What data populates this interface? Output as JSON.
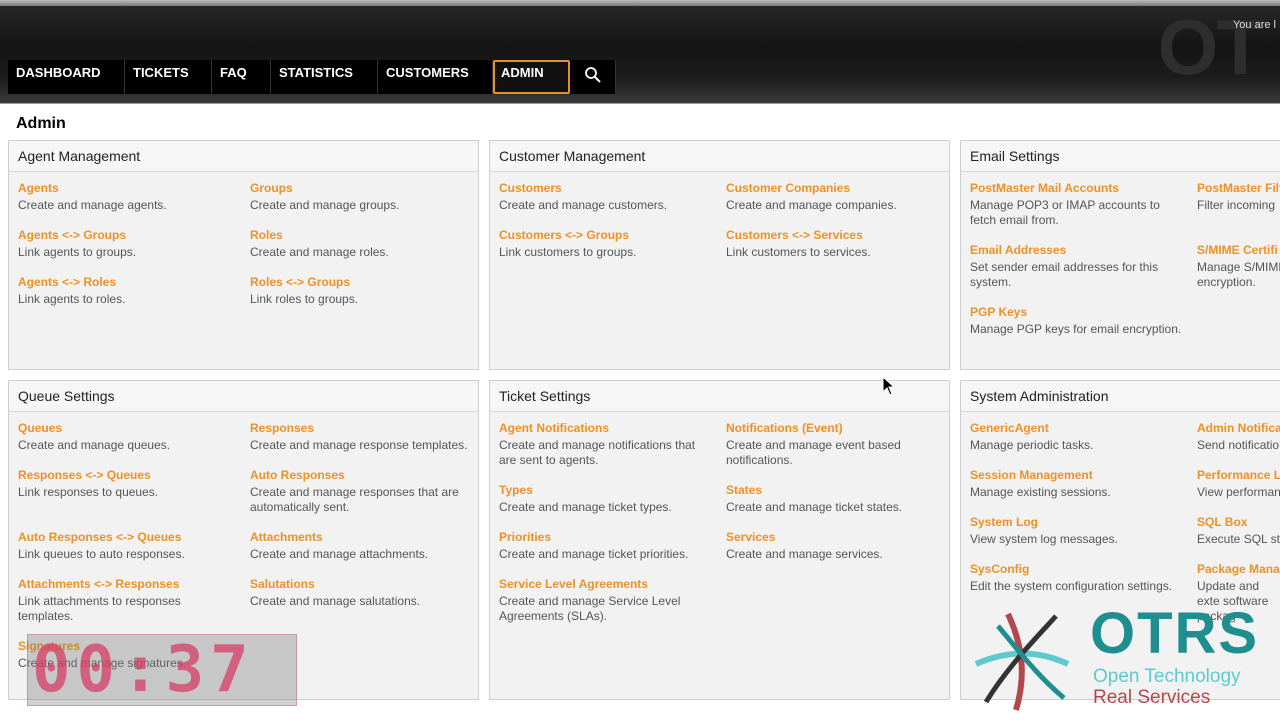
{
  "header": {
    "watermark": "OT",
    "user_text": "You are l"
  },
  "nav": {
    "items": [
      "DASHBOARD",
      "TICKETS",
      "FAQ",
      "STATISTICS",
      "CUSTOMERS",
      "ADMIN"
    ],
    "active": "ADMIN",
    "search_icon": "search-icon"
  },
  "page_title": "Admin",
  "panels": {
    "agent": {
      "title": "Agent Management",
      "entries": [
        {
          "link": "Agents",
          "desc": "Create and manage agents."
        },
        {
          "link": "Groups",
          "desc": "Create and manage groups."
        },
        {
          "link": "Agents <-> Groups",
          "desc": "Link agents to groups."
        },
        {
          "link": "Roles",
          "desc": "Create and manage roles."
        },
        {
          "link": "Agents <-> Roles",
          "desc": "Link agents to roles."
        },
        {
          "link": "Roles <-> Groups",
          "desc": "Link roles to groups."
        }
      ]
    },
    "customer": {
      "title": "Customer Management",
      "entries": [
        {
          "link": "Customers",
          "desc": "Create and manage customers."
        },
        {
          "link": "Customer Companies",
          "desc": "Create and manage companies."
        },
        {
          "link": "Customers <-> Groups",
          "desc": "Link customers to groups."
        },
        {
          "link": "Customers <-> Services",
          "desc": "Link customers to services."
        }
      ]
    },
    "email": {
      "title": "Email Settings",
      "entries": [
        {
          "link": "PostMaster Mail Accounts",
          "desc": "Manage POP3 or IMAP accounts to fetch email from."
        },
        {
          "link": "PostMaster Filt",
          "desc": "Filter incoming"
        },
        {
          "link": "Email Addresses",
          "desc": "Set sender email addresses for this system."
        },
        {
          "link": "S/MIME Certifi",
          "desc": "Manage S/MIME encryption."
        },
        {
          "link": "PGP Keys",
          "desc": "Manage PGP keys for email encryption."
        }
      ]
    },
    "queue": {
      "title": "Queue Settings",
      "entries": [
        {
          "link": "Queues",
          "desc": "Create and manage queues."
        },
        {
          "link": "Responses",
          "desc": "Create and manage response templates."
        },
        {
          "link": "Responses <-> Queues",
          "desc": "Link responses to queues."
        },
        {
          "link": "Auto Responses",
          "desc": "Create and manage responses that are automatically sent."
        },
        {
          "link": "Auto Responses <-> Queues",
          "desc": "Link queues to auto responses."
        },
        {
          "link": "Attachments",
          "desc": "Create and manage attachments."
        },
        {
          "link": "Attachments <-> Responses",
          "desc": "Link attachments to responses templates."
        },
        {
          "link": "Salutations",
          "desc": "Create and manage salutations."
        },
        {
          "link": "Signatures",
          "desc": "Create and manage signatures."
        }
      ]
    },
    "ticket": {
      "title": "Ticket Settings",
      "entries": [
        {
          "link": "Agent Notifications",
          "desc": "Create and manage notifications that are sent to agents."
        },
        {
          "link": "Notifications (Event)",
          "desc": "Create and manage event based notifications."
        },
        {
          "link": "Types",
          "desc": "Create and manage ticket types."
        },
        {
          "link": "States",
          "desc": "Create and manage ticket states."
        },
        {
          "link": "Priorities",
          "desc": "Create and manage ticket priorities."
        },
        {
          "link": "Services",
          "desc": "Create and manage services."
        },
        {
          "link": "Service Level Agreements",
          "desc": "Create and manage Service Level Agreements (SLAs)."
        }
      ]
    },
    "system": {
      "title": "System Administration",
      "entries": [
        {
          "link": "GenericAgent",
          "desc": "Manage periodic tasks."
        },
        {
          "link": "Admin Notifica",
          "desc": "Send notificatio"
        },
        {
          "link": "Session Management",
          "desc": "Manage existing sessions."
        },
        {
          "link": "Performance L",
          "desc": "View performan"
        },
        {
          "link": "System Log",
          "desc": "View system log messages."
        },
        {
          "link": "SQL Box",
          "desc": "Execute SQL sta"
        },
        {
          "link": "SysConfig",
          "desc": "Edit the system configuration settings."
        },
        {
          "link": "Package Mana",
          "desc": "Update and exte software packag"
        }
      ]
    }
  },
  "overlay": {
    "timer": "00:37",
    "logo": {
      "name": "OTRS",
      "line1": "Open Technology",
      "line2": "Real Services"
    }
  },
  "colors": {
    "link": "#ee9126",
    "active_tab_border": "#e88f2a",
    "logo_teal": "#1e8e8e",
    "logo_red": "#b2484e"
  }
}
